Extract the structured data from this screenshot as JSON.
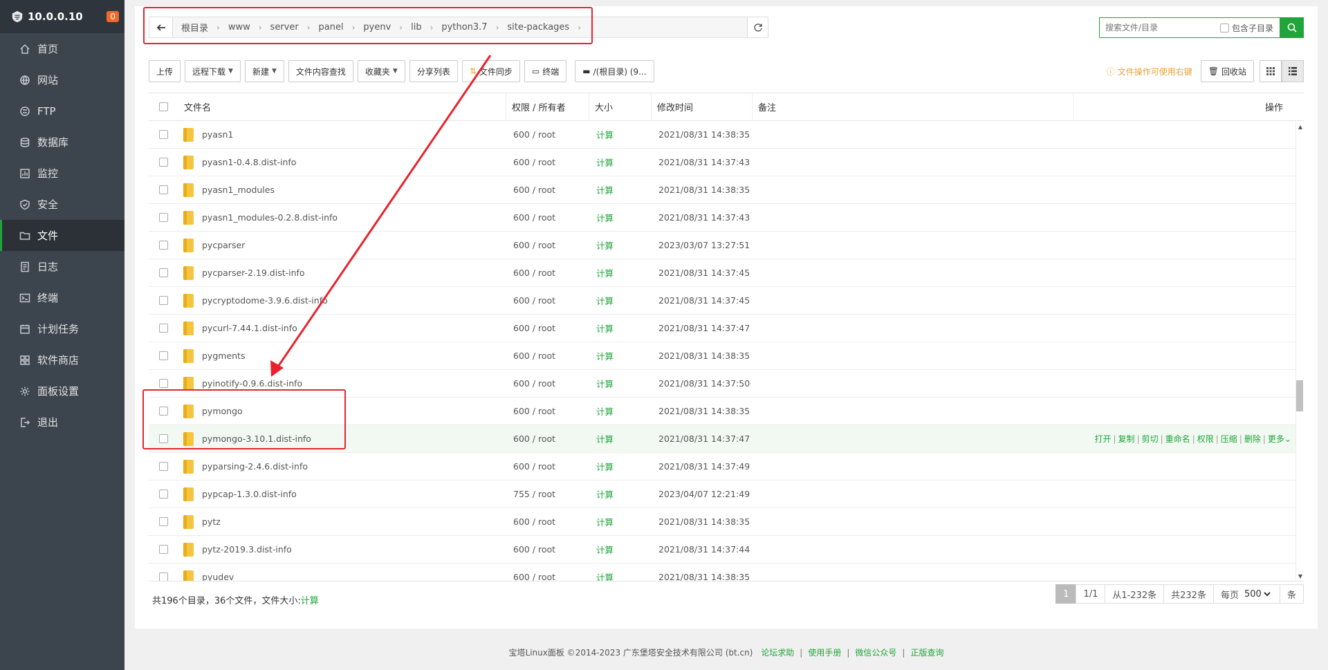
{
  "sidebar": {
    "host": "10.0.0.10",
    "badge": "0",
    "items": [
      {
        "label": "首页",
        "icon": "home-icon"
      },
      {
        "label": "网站",
        "icon": "globe-icon"
      },
      {
        "label": "FTP",
        "icon": "ftp-icon"
      },
      {
        "label": "数据库",
        "icon": "database-icon"
      },
      {
        "label": "监控",
        "icon": "monitor-icon"
      },
      {
        "label": "安全",
        "icon": "shield-icon"
      },
      {
        "label": "文件",
        "icon": "folder-icon",
        "active": true
      },
      {
        "label": "日志",
        "icon": "log-icon"
      },
      {
        "label": "终端",
        "icon": "terminal-icon"
      },
      {
        "label": "计划任务",
        "icon": "calendar-icon"
      },
      {
        "label": "软件商店",
        "icon": "apps-icon"
      },
      {
        "label": "面板设置",
        "icon": "gear-icon"
      },
      {
        "label": "退出",
        "icon": "logout-icon"
      }
    ]
  },
  "breadcrumb": [
    "根目录",
    "www",
    "server",
    "panel",
    "pyenv",
    "lib",
    "python3.7",
    "site-packages"
  ],
  "search": {
    "placeholder": "搜索文件/目录",
    "subdir_label": "包含子目录"
  },
  "toolbar": {
    "upload": "上传",
    "remote_download": "远程下载",
    "new": "新建",
    "content_search": "文件内容查找",
    "favorites": "收藏夹",
    "share_list": "分享列表",
    "file_sync": "文件同步",
    "terminal": "终端",
    "disk": "/(根目录) (9..."
  },
  "hint": "文件操作可使用右键",
  "recycle": "回收站",
  "columns": {
    "name": "文件名",
    "perm": "权限 / 所有者",
    "size": "大小",
    "mtime": "修改时间",
    "note": "备注",
    "ops": "操作"
  },
  "rows": [
    {
      "name": "pyasn1",
      "perm": "600 / root",
      "size": "计算",
      "mtime": "2021/08/31 14:38:35"
    },
    {
      "name": "pyasn1-0.4.8.dist-info",
      "perm": "600 / root",
      "size": "计算",
      "mtime": "2021/08/31 14:37:43"
    },
    {
      "name": "pyasn1_modules",
      "perm": "600 / root",
      "size": "计算",
      "mtime": "2021/08/31 14:38:35"
    },
    {
      "name": "pyasn1_modules-0.2.8.dist-info",
      "perm": "600 / root",
      "size": "计算",
      "mtime": "2021/08/31 14:37:43"
    },
    {
      "name": "pycparser",
      "perm": "600 / root",
      "size": "计算",
      "mtime": "2023/03/07 13:27:51"
    },
    {
      "name": "pycparser-2.19.dist-info",
      "perm": "600 / root",
      "size": "计算",
      "mtime": "2021/08/31 14:37:45"
    },
    {
      "name": "pycryptodome-3.9.6.dist-info",
      "perm": "600 / root",
      "size": "计算",
      "mtime": "2021/08/31 14:37:45"
    },
    {
      "name": "pycurl-7.44.1.dist-info",
      "perm": "600 / root",
      "size": "计算",
      "mtime": "2021/08/31 14:37:47"
    },
    {
      "name": "pygments",
      "perm": "600 / root",
      "size": "计算",
      "mtime": "2021/08/31 14:38:35"
    },
    {
      "name": "pyinotify-0.9.6.dist-info",
      "perm": "600 / root",
      "size": "计算",
      "mtime": "2021/08/31 14:37:50"
    },
    {
      "name": "pymongo",
      "perm": "600 / root",
      "size": "计算",
      "mtime": "2021/08/31 14:38:35"
    },
    {
      "name": "pymongo-3.10.1.dist-info",
      "perm": "600 / root",
      "size": "计算",
      "mtime": "2021/08/31 14:37:47",
      "hover": true
    },
    {
      "name": "pyparsing-2.4.6.dist-info",
      "perm": "600 / root",
      "size": "计算",
      "mtime": "2021/08/31 14:37:49"
    },
    {
      "name": "pypcap-1.3.0.dist-info",
      "perm": "755 / root",
      "size": "计算",
      "mtime": "2023/04/07 12:21:49"
    },
    {
      "name": "pytz",
      "perm": "600 / root",
      "size": "计算",
      "mtime": "2021/08/31 14:38:35"
    },
    {
      "name": "pytz-2019.3.dist-info",
      "perm": "600 / root",
      "size": "计算",
      "mtime": "2021/08/31 14:37:44"
    },
    {
      "name": "pyudev",
      "perm": "600 / root",
      "size": "计算",
      "mtime": "2021/08/31 14:38:35"
    }
  ],
  "row_actions": [
    "打开",
    "复制",
    "剪切",
    "重命名",
    "权限",
    "压缩",
    "删除",
    "更多"
  ],
  "summary": {
    "text": "共196个目录，36个文件，文件大小:",
    "link": "计算"
  },
  "pager": {
    "current": "1",
    "pages": "1/1",
    "range": "从1-232条",
    "total": "共232条",
    "per_page_label": "每页",
    "per_page": "500",
    "unit": "条"
  },
  "footer": {
    "copyright": "宝塔Linux面板 ©2014-2023 广东堡塔安全技术有限公司 (bt.cn)",
    "links": [
      "论坛求助",
      "使用手册",
      "微信公众号",
      "正版查询"
    ]
  },
  "colors": {
    "accent": "#20a53a",
    "annotation": "#e8222c",
    "sidebar": "#3c444d"
  }
}
